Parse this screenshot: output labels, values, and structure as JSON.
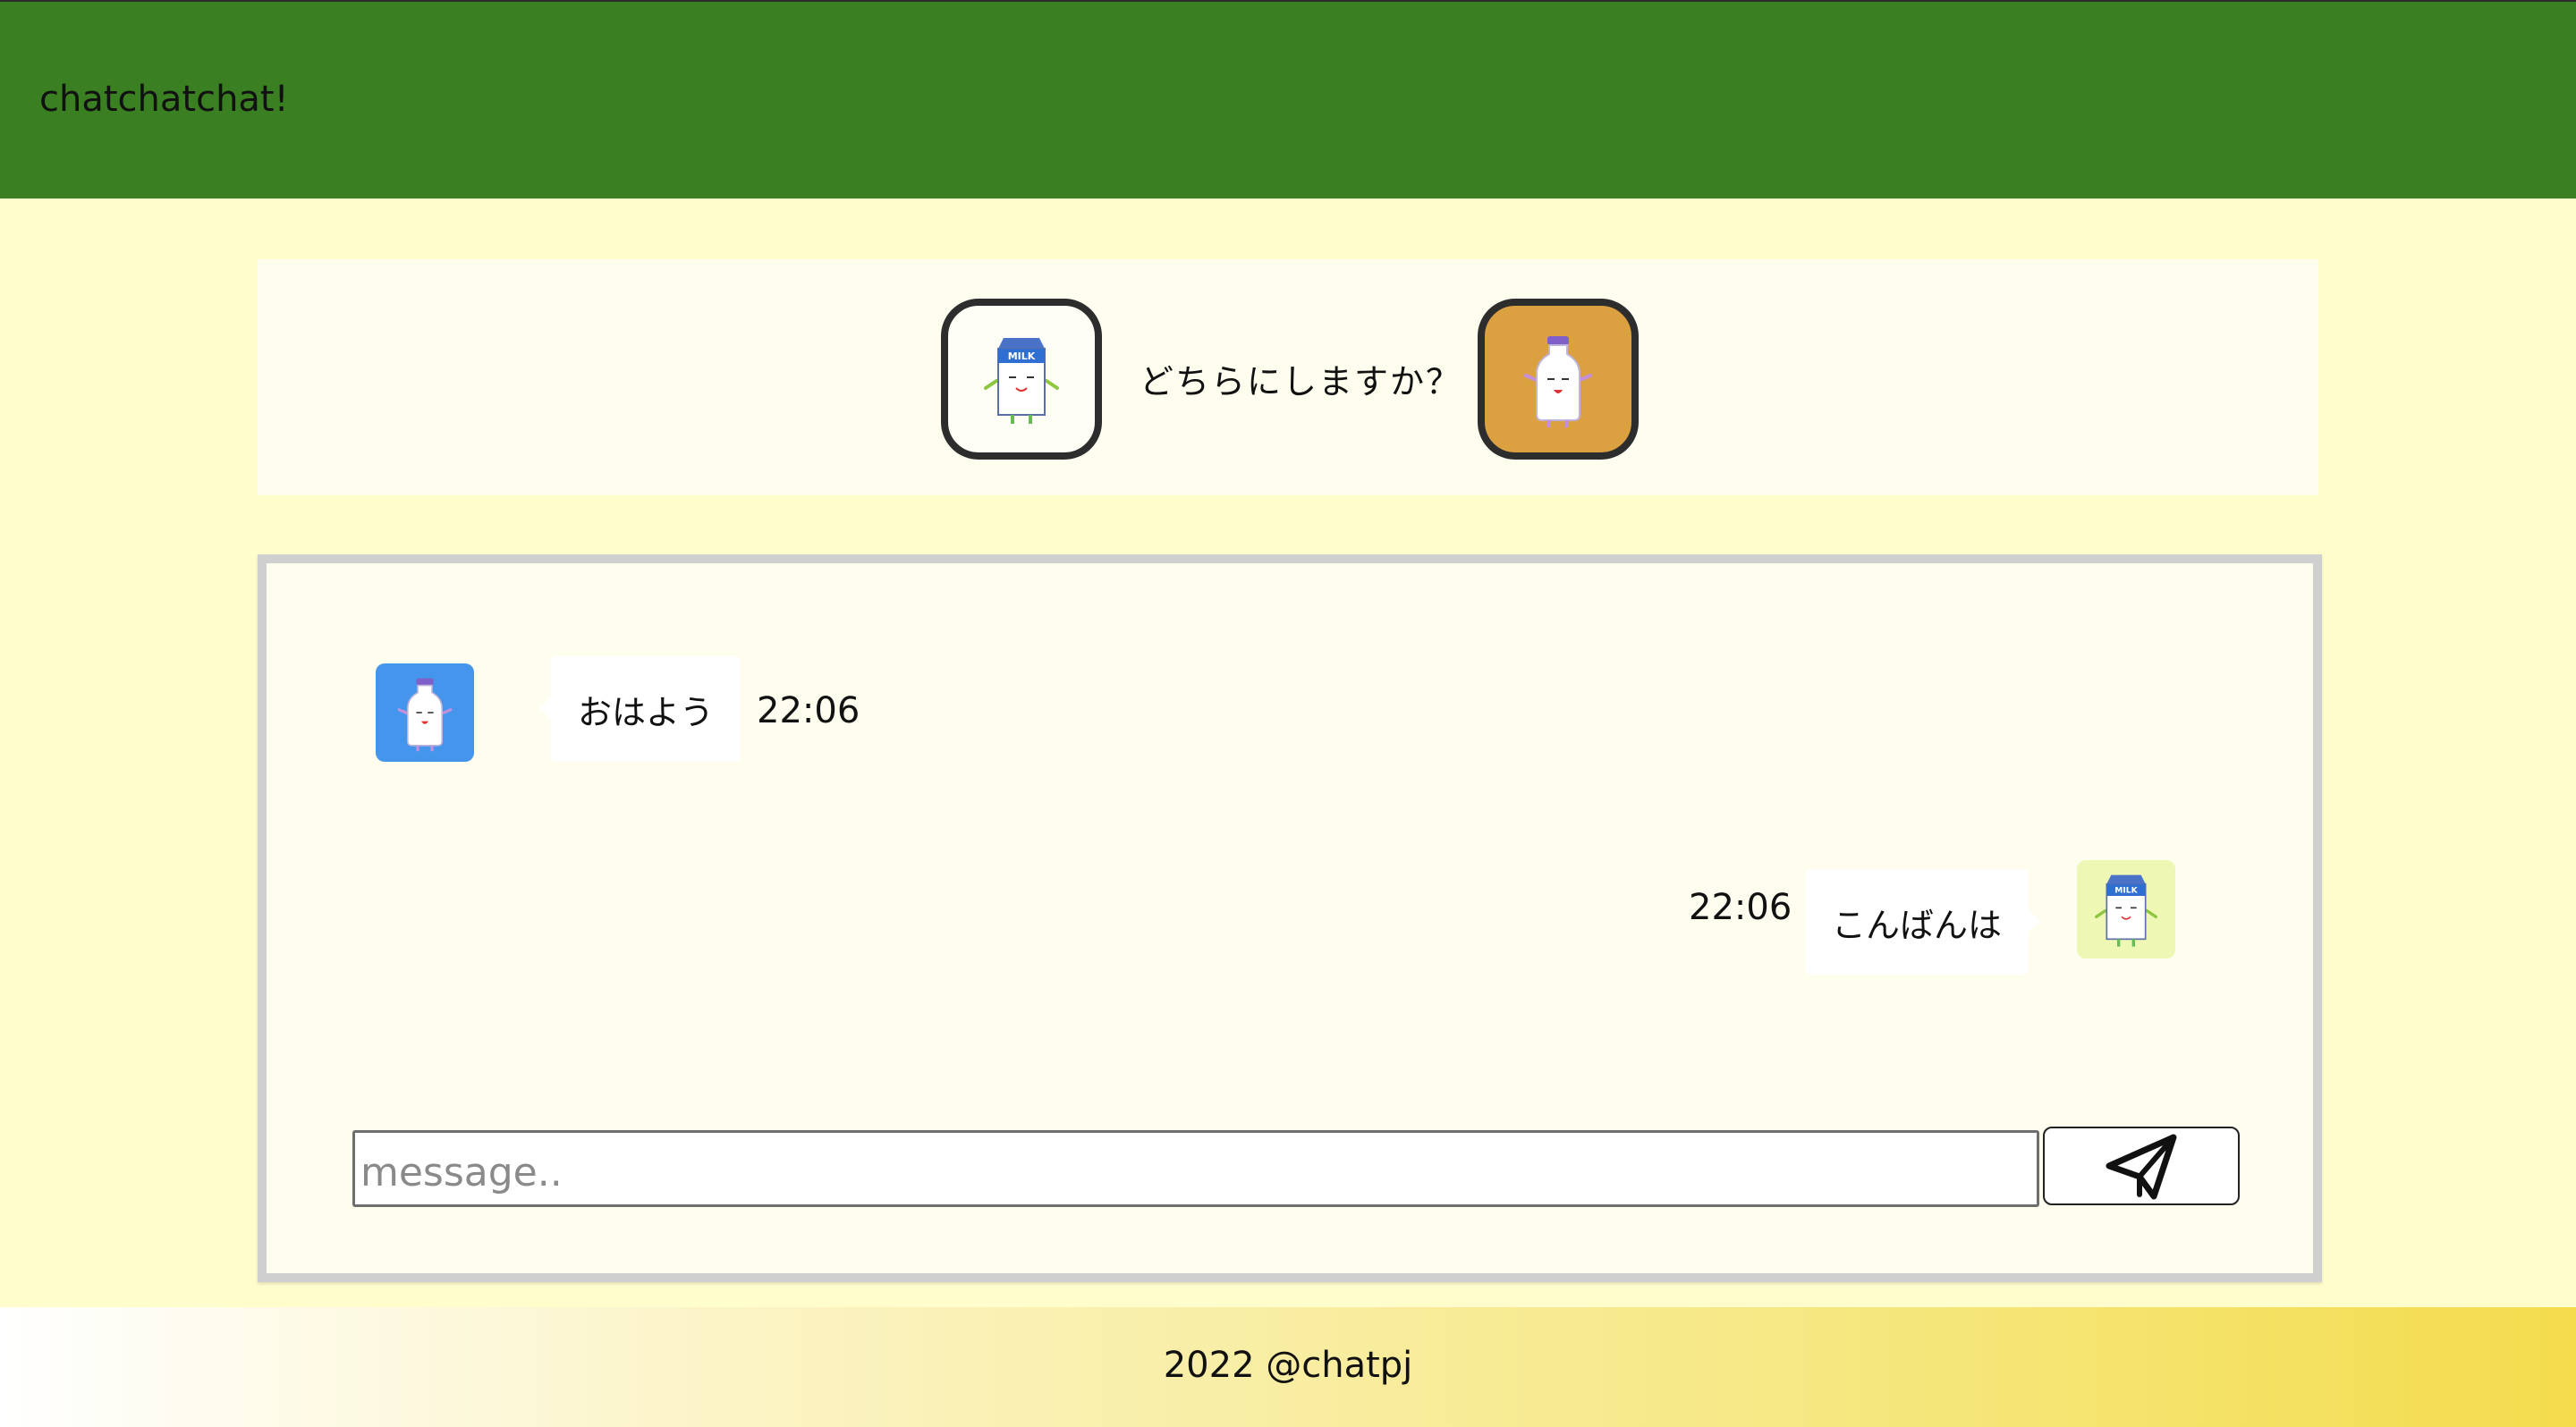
{
  "header": {
    "brand": "chatchatchat!",
    "bg_color": "#3a8022"
  },
  "chooser": {
    "prompt": "どちらにしますか？",
    "options": [
      {
        "name": "milk-carton",
        "icon": "milk-carton-icon",
        "bg_color": "#fffef6",
        "carton_label": "MILK"
      },
      {
        "name": "milk-bottle",
        "icon": "milk-bottle-icon",
        "bg_color": "#dba040"
      }
    ]
  },
  "chat": {
    "messages": [
      {
        "side": "left",
        "avatar": "milk-bottle-icon",
        "avatar_bg": "#4496ec",
        "text": "おはよう",
        "time": "22:06"
      },
      {
        "side": "right",
        "avatar": "milk-carton-icon",
        "avatar_bg": "#eef7b4",
        "text": "こんばんは",
        "time": "22:06",
        "carton_label": "MILK"
      }
    ],
    "input": {
      "placeholder": "message..",
      "value": ""
    },
    "send_icon": "paper-plane-icon"
  },
  "footer": {
    "copyright": "2022 @chatpj"
  }
}
